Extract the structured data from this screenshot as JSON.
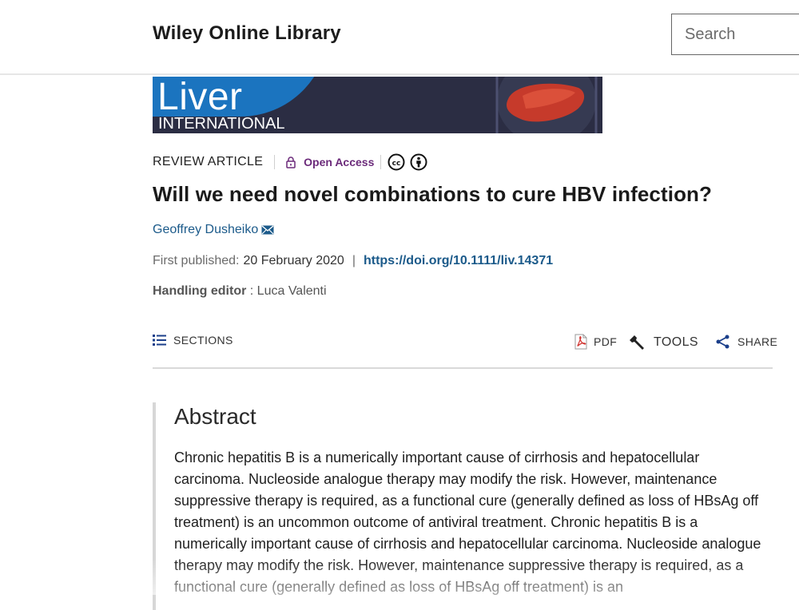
{
  "header": {
    "brand": "Wiley Online Library",
    "search_placeholder": "Search"
  },
  "journal": {
    "name_line1": "Liver",
    "name_line2": "INTERNATIONAL"
  },
  "article": {
    "type": "REVIEW ARTICLE",
    "access": "Open Access",
    "title": "Will we need novel combinations to cure HBV infection?",
    "author": "Geoffrey Dusheiko",
    "first_published_label": "First published:",
    "first_published_date": "20 February 2020",
    "doi": "https://doi.org/10.1111/liv.14371",
    "editor_label": "Handling editor",
    "editor_name": "Luca Valenti"
  },
  "toolbar": {
    "sections": "SECTIONS",
    "pdf": "PDF",
    "tools": "TOOLS",
    "share": "SHARE"
  },
  "abstract": {
    "heading": "Abstract",
    "text": "Chronic hepatitis B is a numerically important cause of cirrhosis and hepatocellular carcinoma. Nucleoside analogue therapy may modify the risk. However, maintenance suppressive therapy is required, as a functional cure (generally defined as loss of HBsAg off treatment) is an uncommon outcome of antiviral treatment. Chronic hepatitis B is a numerically important cause of cirrhosis and hepatocellular carcinoma. Nucleoside analogue therapy may modify the risk. However, maintenance suppressive therapy is required, as a functional cure (generally defined as loss of HBsAg off treatment) is an"
  },
  "icons": {
    "lock": "lock-icon",
    "cc": "creative-commons-icon",
    "by": "attribution-icon",
    "email": "email-icon",
    "sections": "list-icon",
    "pdf": "pdf-icon",
    "tools": "wrench-icon",
    "share": "share-icon"
  },
  "colors": {
    "open_access": "#6b2a7a",
    "link": "#1b5a8a",
    "banner_bg": "#2b2d43",
    "banner_accent": "#1b74bf"
  }
}
